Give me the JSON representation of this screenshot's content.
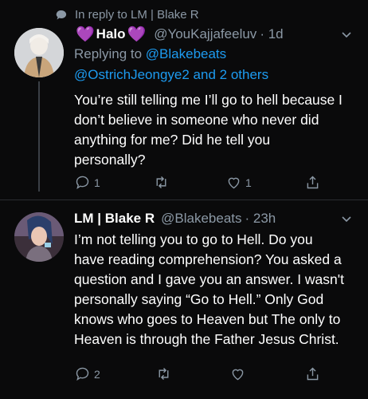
{
  "context": {
    "text": "In reply to LM | Blake R",
    "icon": "speech-bubble-icon"
  },
  "tweets": [
    {
      "name": "Halo",
      "name_prefix": "💜",
      "name_suffix": "💜",
      "handle": "@YouKajjafeeluv",
      "time": "· 1d",
      "replying_prefix": "Replying to ",
      "replying_user": "@Blakebeats",
      "replying_more_user": "@OstrichJeongye2",
      "replying_more_rest": " and 2 others",
      "text": "You’re still telling me I’ll go to hell because I don’t believe in someone who never did anything for me? Did he tell you personally?",
      "reply_count": "1",
      "retweet_count": "",
      "like_count": "1"
    },
    {
      "name": "LM | Blake R",
      "handle": "@Blakebeats",
      "time": "· 23h",
      "text": "I’m not telling you to go to Hell. Do you have reading comprehension? You asked a question and I gave you an answer. I wasn't personally saying “Go to Hell.” Only God knows who goes to Heaven but The only to Heaven is through the Father Jesus Christ.",
      "reply_count": "2",
      "retweet_count": "",
      "like_count": ""
    }
  ],
  "colors": {
    "background": "#0a0a0b",
    "muted": "#8b98a5",
    "link": "#1d9bf0",
    "heart": "#b05ad4"
  }
}
